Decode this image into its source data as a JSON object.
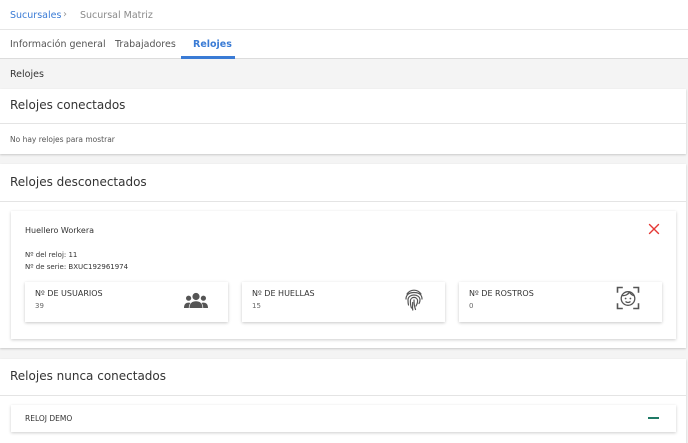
{
  "breadcrumb": {
    "root": "Sucursales",
    "separator": "›",
    "current": "Sucursal Matriz"
  },
  "tabs": [
    {
      "label": "Información general",
      "active": false
    },
    {
      "label": "Trabajadores",
      "active": false
    },
    {
      "label": "Relojes",
      "active": true
    }
  ],
  "section_label": "Relojes",
  "connected": {
    "title": "Relojes conectados",
    "empty_text": "No hay relojes para mostrar"
  },
  "disconnected": {
    "title": "Relojes desconectados",
    "clock": {
      "name": "Huellero Workera",
      "number_line": "Nº del reloj: 11",
      "serial_line": "Nº de serie: BXUC192961974",
      "stats": [
        {
          "label": "Nº DE USUARIOS",
          "value": "39",
          "icon": "users-icon"
        },
        {
          "label": "Nº DE HUELLAS",
          "value": "15",
          "icon": "fingerprint-icon"
        },
        {
          "label": "Nº DE ROSTROS",
          "value": "0",
          "icon": "face-scan-icon"
        }
      ]
    }
  },
  "never_connected": {
    "title": "Relojes nunca conectados",
    "item": "RELOJ DEMO"
  },
  "colors": {
    "accent": "#3a7bd5",
    "close": "#e53935",
    "collapse": "#1f7a66",
    "icon": "#555555"
  }
}
